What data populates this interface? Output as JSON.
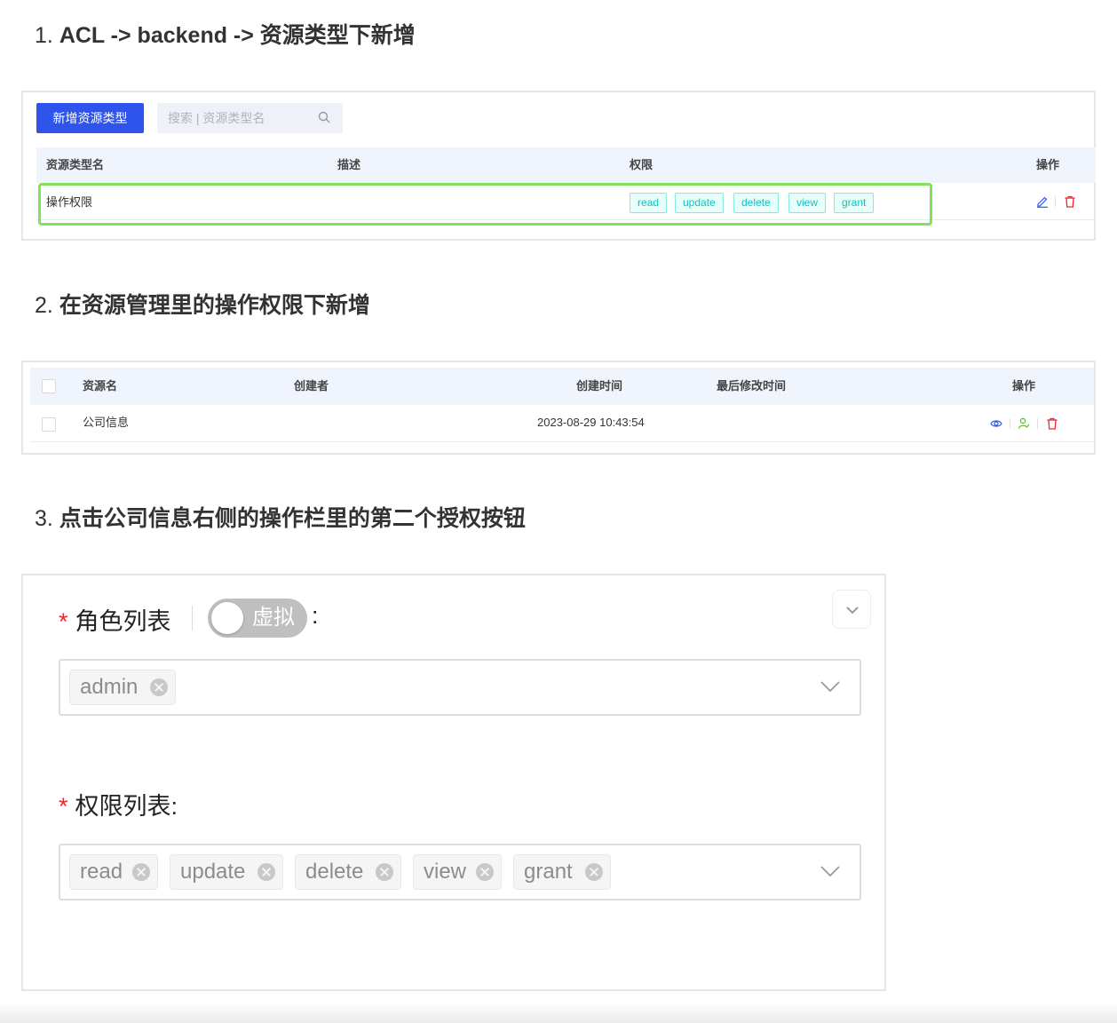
{
  "steps": [
    {
      "number": "1.",
      "text": "ACL -> backend -> 资源类型下新增"
    },
    {
      "number": "2.",
      "text": "在资源管理里的操作权限下新增"
    },
    {
      "number": "3.",
      "text": "点击公司信息右侧的操作栏里的第二个授权按钮"
    }
  ],
  "resource_types": {
    "add_button": "新增资源类型",
    "search_placeholder": "搜索 | 资源类型名",
    "columns": [
      "资源类型名",
      "描述",
      "权限",
      "操作"
    ],
    "rows": [
      {
        "name": "操作权限",
        "description": "",
        "permissions": [
          "read",
          "update",
          "delete",
          "view",
          "grant"
        ]
      }
    ]
  },
  "resources": {
    "columns": [
      "资源名",
      "创建者",
      "创建时间",
      "最后修改时间",
      "操作"
    ],
    "rows": [
      {
        "name": "公司信息",
        "creator": "",
        "created_at": "2023-08-29 10:43:54",
        "modified_at": ""
      }
    ]
  },
  "grant_form": {
    "role_label": "角色列表",
    "switch_text": "虚拟",
    "colon": ":",
    "roles": [
      "admin"
    ],
    "permission_label": "权限列表:",
    "permissions": [
      "read",
      "update",
      "delete",
      "view",
      "grant"
    ]
  },
  "colors": {
    "primary": "#2f54eb",
    "tag_text": "#13c2c2",
    "tag_bg": "#e6fffb",
    "highlight": "#7ee35a",
    "required": "#f5222d",
    "delete": "#f5222d",
    "grant_icon": "#52c41a"
  }
}
